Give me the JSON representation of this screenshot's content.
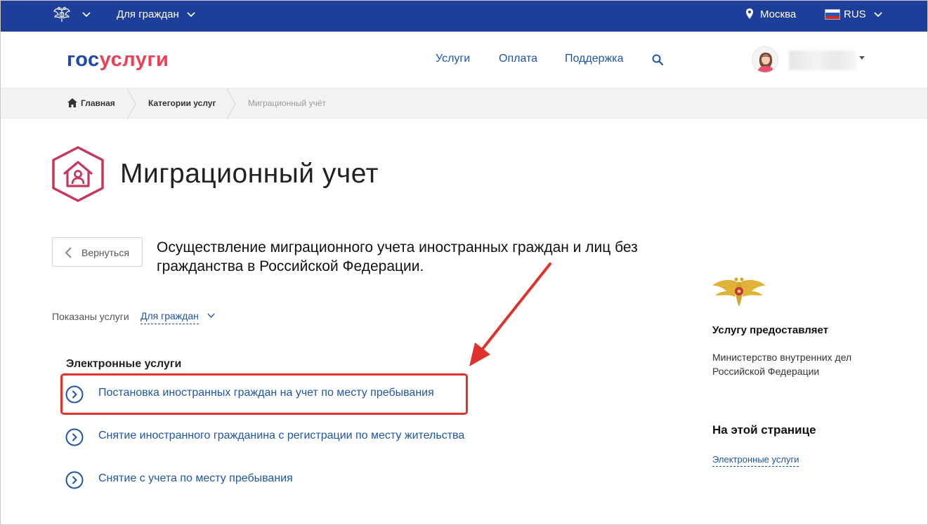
{
  "topbar": {
    "audience_label": "Для граждан",
    "city": "Москва",
    "language": "RUS",
    "colors": {
      "background": "#1d3f9a",
      "text": "#ffffff"
    }
  },
  "header": {
    "logo_part1": "гос",
    "logo_part2": "услуги",
    "nav": [
      {
        "label": "Услуги"
      },
      {
        "label": "Оплата"
      },
      {
        "label": "Поддержка"
      }
    ],
    "icons": {
      "search": "search-icon",
      "avatar": "user-avatar",
      "menu": "caret-down-icon"
    },
    "colors": {
      "logo_blue": "#1f4aa8",
      "logo_red": "#ee3f58",
      "nav_link": "#1f56a5"
    }
  },
  "breadcrumb": {
    "items": [
      {
        "label": "Главная"
      },
      {
        "label": "Категории услуг"
      },
      {
        "label": "Миграционный учёт"
      }
    ]
  },
  "page": {
    "title": "Миграционный учет",
    "back_label": "Вернуться",
    "description": "Осуществление миграционного учета иностранных граждан и лиц без гражданства в Российской Федерации.",
    "filter_label": "Показаны услуги",
    "filter_value": "Для граждан",
    "section_title": "Электронные услуги",
    "services": [
      {
        "label": "Постановка иностранных граждан на учет по месту пребывания",
        "highlighted": true
      },
      {
        "label": "Снятие иностранного гражданина с регистрации по месту жительства",
        "highlighted": false
      },
      {
        "label": "Снятие с учета по месту пребывания",
        "highlighted": false
      }
    ],
    "colors": {
      "accent_pink": "#c7375c",
      "link": "#1f56a5",
      "annotation_red": "#e0322d"
    }
  },
  "sidebar": {
    "provider_heading": "Услугу предоставляет",
    "provider_name": "Министерство внутренних дел Российской Федерации",
    "on_page_heading": "На этой странице",
    "on_page_link": "Электронные услуги"
  }
}
